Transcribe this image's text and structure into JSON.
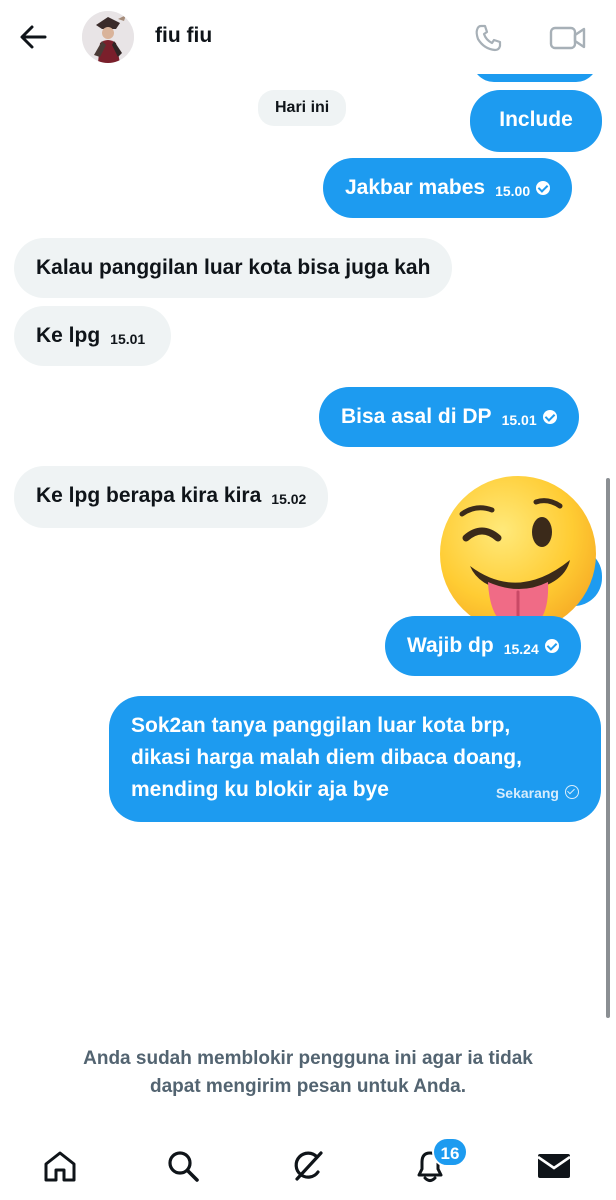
{
  "header": {
    "title": "fiu fiu",
    "back_icon": "arrow-left-icon",
    "call_icon": "phone-icon",
    "video_icon": "video-camera-icon"
  },
  "chat": {
    "date_divider": "Hari ini",
    "messages": [
      {
        "side": "sent",
        "text": "Include",
        "time": ""
      },
      {
        "side": "sent",
        "text": "Jakbar mabes",
        "time": "15.00"
      },
      {
        "side": "received",
        "text": "Kalau panggilan luar kota bisa juga kah",
        "time": ""
      },
      {
        "side": "received",
        "text": "Ke lpg",
        "time": "15.01"
      },
      {
        "side": "sent",
        "text": "Bisa asal di DP",
        "time": "15.01"
      },
      {
        "side": "received",
        "text": "Ke lpg berapa kira kira",
        "time": "15.02"
      },
      {
        "side": "sent",
        "text": "Wajib dp",
        "time": "15.24"
      },
      {
        "side": "sent",
        "lines": [
          "Sok2an tanya panggilan luar kota brp,",
          "dikasi harga malah diem dibaca doang,",
          "mending ku blokir aja bye"
        ],
        "time": "Sekarang"
      }
    ],
    "emoji_icon": "winking-face-with-tongue-emoji"
  },
  "blocked_notice": {
    "line1": "Anda sudah memblokir pengguna ini agar ia tidak",
    "line2": "dapat mengirim pesan untuk Anda."
  },
  "nav": {
    "items": [
      "home-icon",
      "search-icon",
      "grok-icon",
      "notifications-icon",
      "messages-icon"
    ],
    "notification_count": "16"
  },
  "colors": {
    "accent": "#1d9bf0",
    "received_bubble": "#eff3f4",
    "muted_text": "#536471"
  }
}
